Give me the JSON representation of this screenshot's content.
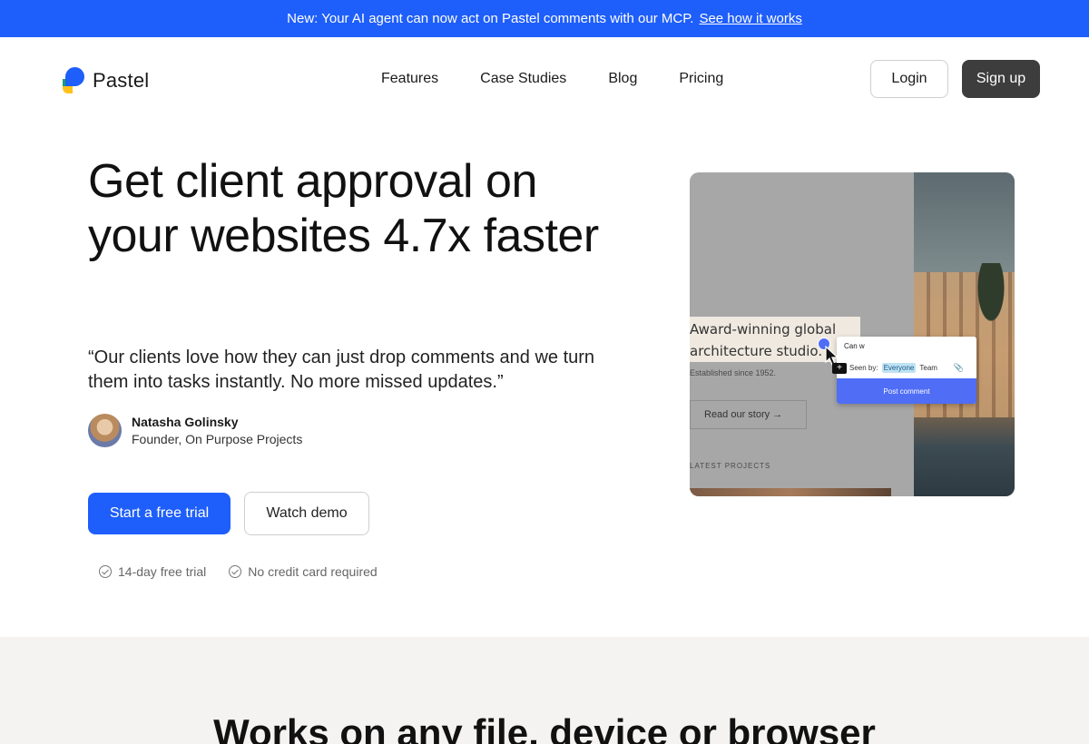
{
  "banner": {
    "text": "New: Your AI agent can now act on Pastel comments with our MCP.",
    "link": "See how it works"
  },
  "brand": {
    "name": "Pastel",
    "accent": "#1e5efa"
  },
  "nav": {
    "links": [
      "Features",
      "Case Studies",
      "Blog",
      "Pricing"
    ],
    "login": "Login",
    "signup": "Sign up"
  },
  "hero": {
    "headline": "Get client approval on your websites 4.7x faster",
    "quote": "“Our clients love how they can just drop comments and we turn them into tasks instantly. No more missed updates.”",
    "author_name": "Natasha Golinsky",
    "author_role": "Founder, On Purpose Projects",
    "cta_primary": "Start a free trial",
    "cta_secondary": "Watch demo",
    "perks": [
      "14-day free trial",
      "No credit card required"
    ]
  },
  "mockup": {
    "title_line1": "Award-winning global",
    "title_line2": "architecture studio.",
    "established": "Established since 1952.",
    "read_story": "Read our story →",
    "latest": "LATEST PROJECTS",
    "comment_input": "Can w",
    "seen_by_label": "Seen by:",
    "seen_everyone": "Everyone",
    "seen_team": "Team",
    "post_button": "Post comment"
  },
  "section2": {
    "title": "Works on any file, device or browser"
  }
}
